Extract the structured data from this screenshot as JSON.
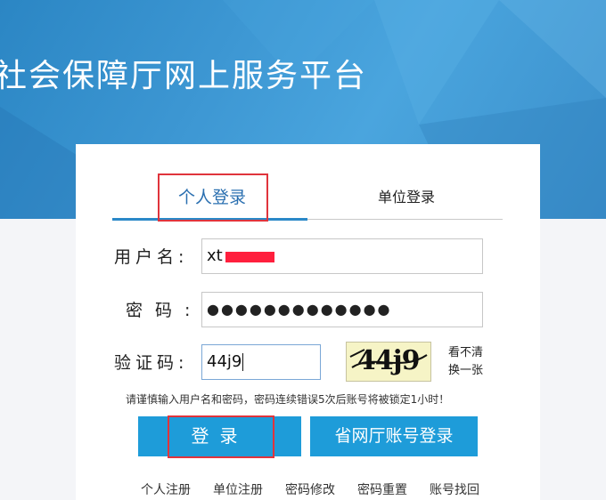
{
  "header": {
    "site_title": "社会保障厅网上服务平台"
  },
  "tabs": [
    {
      "label": "个人登录",
      "active": true
    },
    {
      "label": "单位登录",
      "active": false
    }
  ],
  "form": {
    "username_label": "用户名:",
    "username_value": "xt",
    "password_label": "密码:",
    "password_mask": "●●●●●●●●●●●●●",
    "captcha_label": "验证码:",
    "captcha_value": "44j9",
    "captcha_image_text": "44j9",
    "refresh_line1": "看不清",
    "refresh_line2": "换一张",
    "notice": "请谨慎输入用户名和密码，密码连续错误5次后账号将被锁定1小时！"
  },
  "buttons": {
    "login_label": "登录",
    "province_login_label": "省网厅账号登录"
  },
  "links": [
    "个人注册",
    "单位注册",
    "密码修改",
    "密码重置",
    "账号找回"
  ],
  "colors": {
    "banner_blue": "#3d97d3",
    "active_tab_line": "#2b88c8",
    "button_blue": "#1e9cd9",
    "highlight_red": "#e0343c",
    "captcha_bg": "#f6f4c6"
  }
}
